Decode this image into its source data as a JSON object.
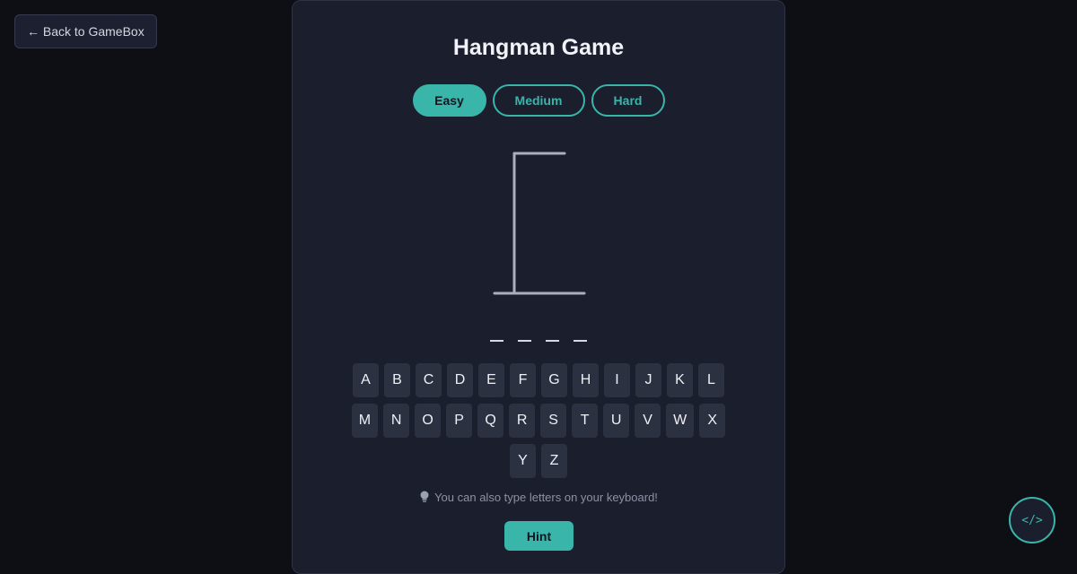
{
  "nav": {
    "back_label": "← Back to GameBox"
  },
  "game": {
    "title": "Hangman Game",
    "difficulty": [
      {
        "label": "Easy",
        "active": true
      },
      {
        "label": "Medium",
        "active": false
      },
      {
        "label": "Hard",
        "active": false
      }
    ],
    "word_length": 4,
    "wrong_guesses": 0,
    "keyboard": {
      "rows": [
        [
          "A",
          "B",
          "C",
          "D",
          "E",
          "F",
          "G",
          "H",
          "I",
          "J",
          "K",
          "L"
        ],
        [
          "M",
          "N",
          "O",
          "P",
          "Q",
          "R",
          "S",
          "T",
          "U",
          "V",
          "W",
          "X"
        ],
        [
          "Y",
          "Z"
        ]
      ]
    },
    "tip": {
      "icon": "lightbulb-icon",
      "text": "You can also type letters on your keyboard!"
    },
    "hint_label": "Hint"
  },
  "code_button": {
    "label": "</>",
    "icon": "code-icon"
  },
  "colors": {
    "accent": "#3ab5aa",
    "panel": "#1b1e2d",
    "background": "#0e0f14",
    "key": "#2c3142"
  }
}
